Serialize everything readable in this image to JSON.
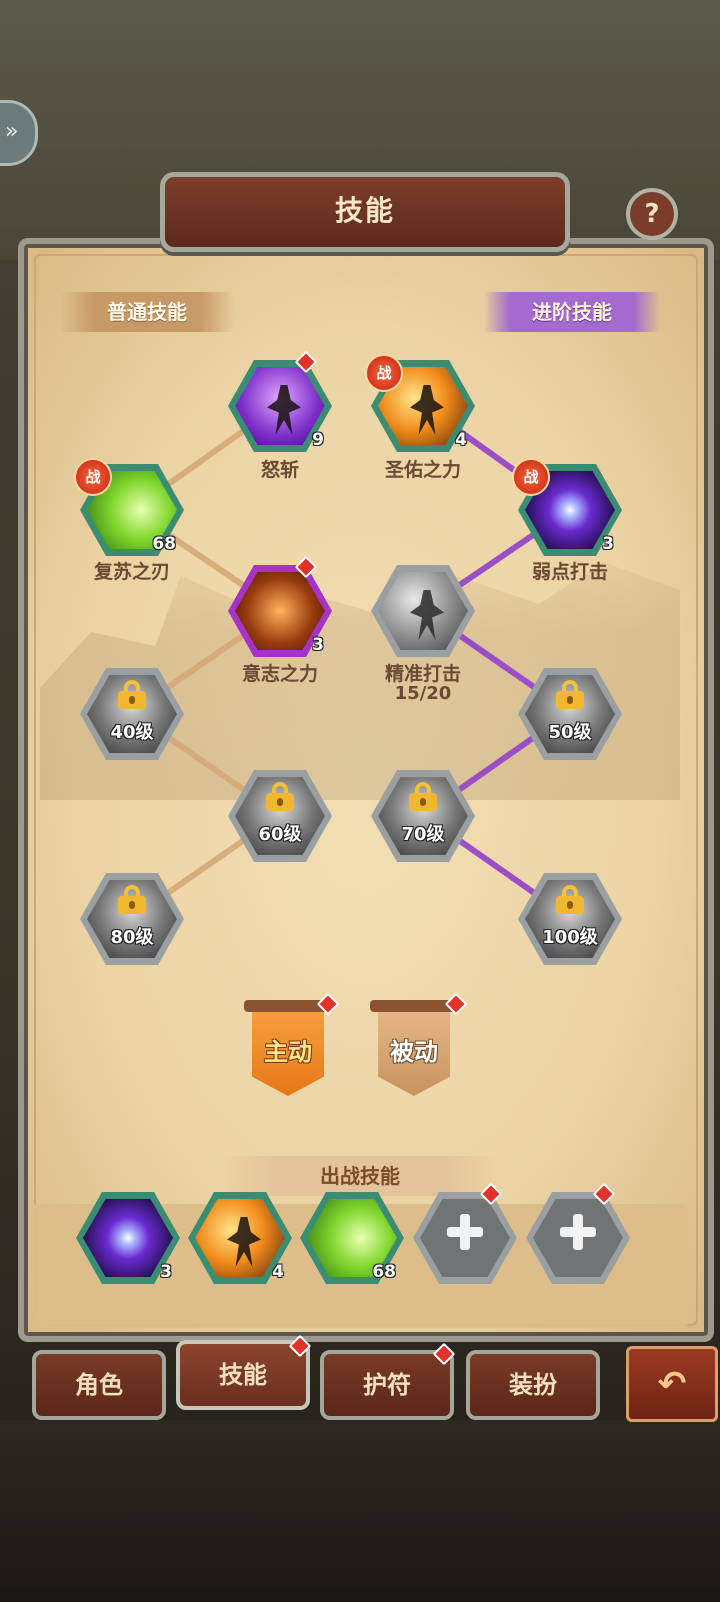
{
  "header": {
    "title": "技能",
    "help_glyph": "?"
  },
  "sections": {
    "normal": "普通技能",
    "advanced": "进阶技能"
  },
  "nodes": {
    "nuzhan": {
      "name": "怒斩",
      "level": "9"
    },
    "shengyou": {
      "name": "圣佑之力",
      "level": "4",
      "badge": "战"
    },
    "fusu": {
      "name": "复苏之刃",
      "level": "68",
      "badge": "战"
    },
    "ruodian": {
      "name": "弱点打击",
      "level": "3",
      "badge": "战"
    },
    "yizhi": {
      "name": "意志之力",
      "level": "3"
    },
    "jingzhun": {
      "name": "精准打击",
      "progress": "15/20"
    },
    "lock40": {
      "level": "40级"
    },
    "lock50": {
      "level": "50级"
    },
    "lock60": {
      "level": "60级"
    },
    "lock70": {
      "level": "70级"
    },
    "lock80": {
      "level": "80级"
    },
    "lock100": {
      "level": "100级"
    }
  },
  "modes": {
    "active": "主动",
    "passive": "被动"
  },
  "battle": {
    "title": "出战技能",
    "slots": [
      {
        "icon": "eye-skill-icon",
        "level": "3"
      },
      {
        "icon": "golden-warrior-skill-icon",
        "level": "4"
      },
      {
        "icon": "green-blade-skill-icon",
        "level": "68"
      },
      {
        "icon": "plus-icon",
        "level": ""
      },
      {
        "icon": "plus-icon",
        "level": ""
      }
    ]
  },
  "tabs": [
    {
      "label": "角色"
    },
    {
      "label": "技能"
    },
    {
      "label": "护符"
    },
    {
      "label": "装扮"
    }
  ],
  "colors": {
    "accent_purple": "#a46ad0",
    "panel": "#ebd3a3",
    "tab": "#7a3a27",
    "notify": "#e0322a"
  }
}
